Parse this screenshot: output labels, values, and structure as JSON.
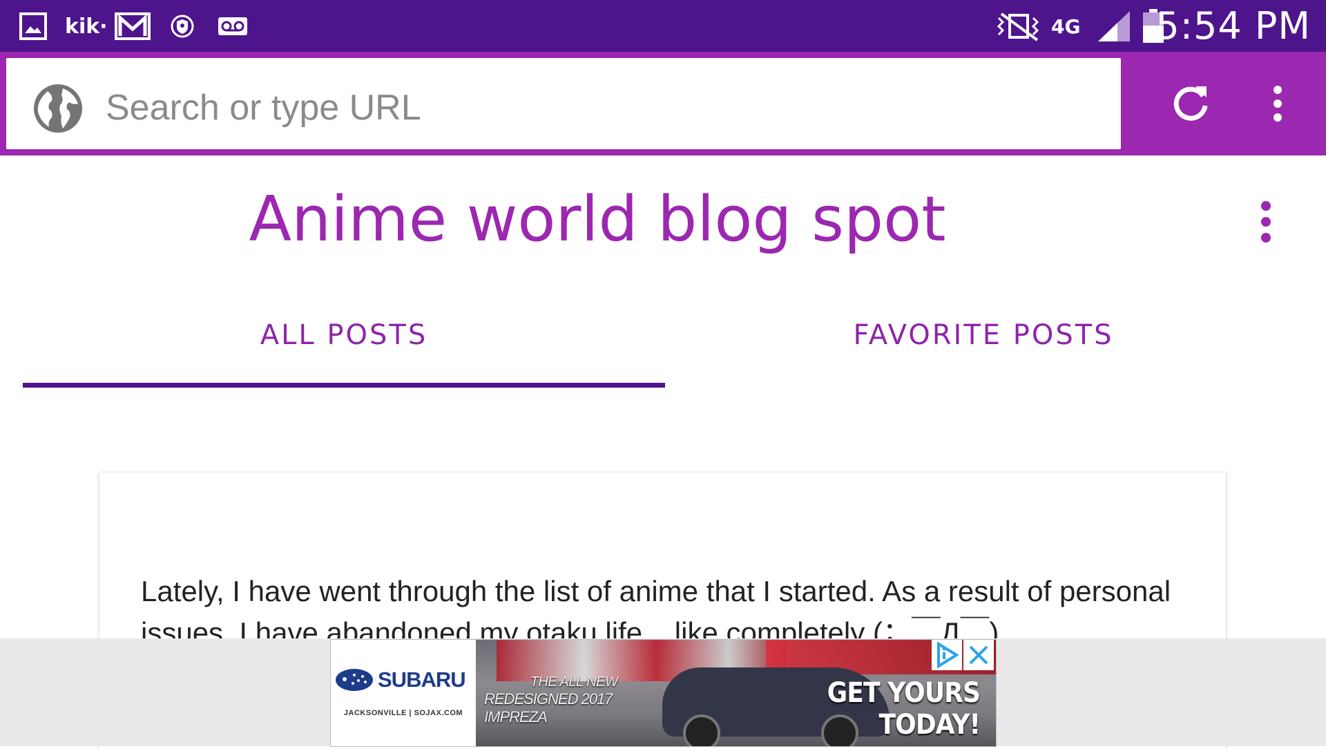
{
  "status_bar": {
    "time": "5:54 PM",
    "left_icons": [
      "gallery-icon",
      "kik-icon",
      "gmail-icon",
      "shield-icon",
      "voicemail-icon"
    ],
    "right_icons": [
      "vibrate-icon",
      "4g-lte-icon",
      "signal-icon",
      "battery-icon"
    ],
    "kik_label": "kik·",
    "network_label": "4G"
  },
  "browser": {
    "url_placeholder": "Search or type URL",
    "reload_label": "reload",
    "menu_label": "more options"
  },
  "blog": {
    "title": "Anime world blog spot"
  },
  "tabs": [
    {
      "label": "ALL POSTS",
      "selected": true
    },
    {
      "label": "FAVORITE POSTS",
      "selected": false
    }
  ],
  "post": {
    "line1": "Lately, I have went through the list of anime that I started. As a result of personal",
    "line2": "issues, I have abandoned my otaku life... like completely (；￣Д￣)"
  },
  "ad": {
    "brand": "SUBARU",
    "dealer": "JACKSONVILLE | SOJAX.COM",
    "tagline_1": "THE ALL NEW",
    "tagline_2": "REDESIGNED 2017 IMPREZA",
    "cta": "GET YOURS TODAY!"
  },
  "colors": {
    "status_bar": "#4e148c",
    "browser_bar": "#9c27b0",
    "accent": "#9c27b0",
    "tab_indicator": "#4e148c"
  }
}
